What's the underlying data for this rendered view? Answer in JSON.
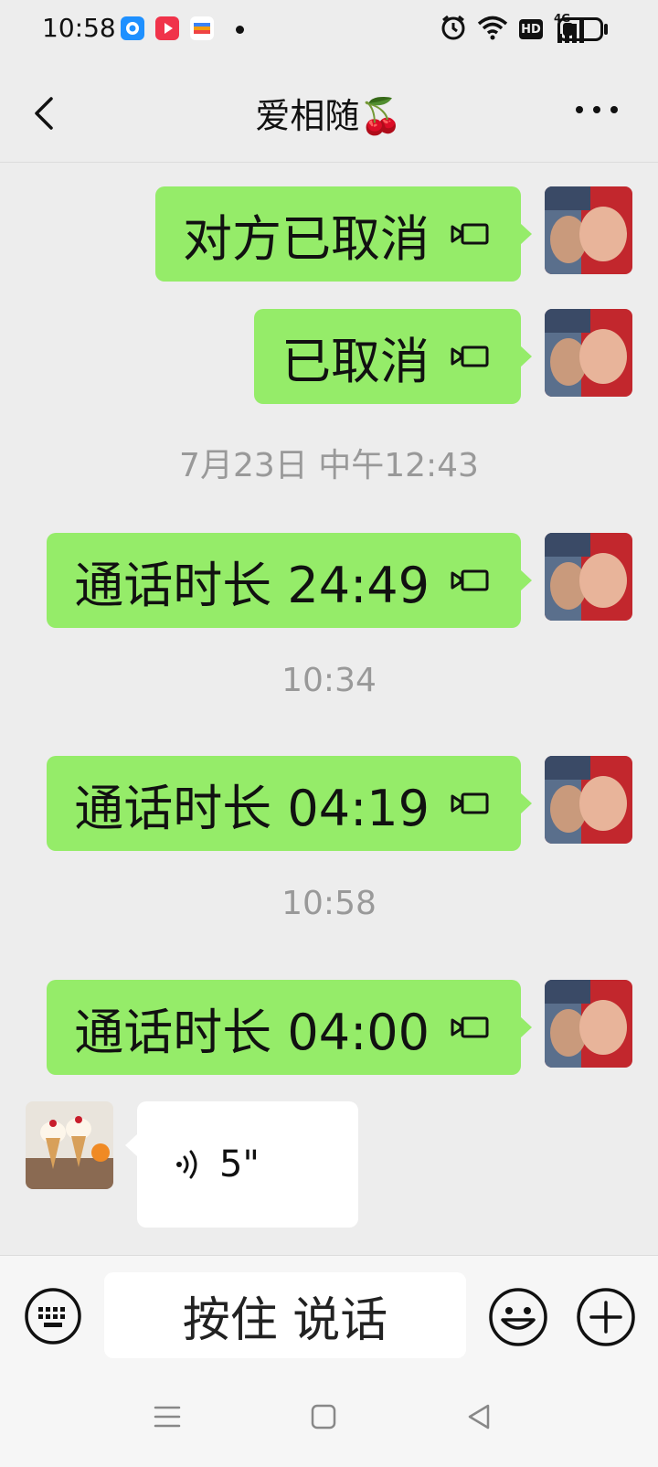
{
  "status_bar": {
    "time": "10:58",
    "app_icons": [
      "browser-icon",
      "video-app-icon",
      "wallet-app-icon"
    ],
    "system_icons": [
      "alarm-icon",
      "wifi-icon",
      "hd-icon",
      "signal-4g-icon",
      "battery-icon"
    ],
    "hd_label": "HD",
    "network_label": "4G",
    "battery_level": 0.3
  },
  "header": {
    "title": "爱相随🍒"
  },
  "messages": [
    {
      "type": "video-call",
      "side": "me",
      "text": "对方已取消"
    },
    {
      "type": "video-call",
      "side": "me",
      "text": "已取消"
    },
    {
      "type": "timestamp",
      "text": "7月23日 中午12:43"
    },
    {
      "type": "video-call",
      "side": "me",
      "text": "通话时长 24:49"
    },
    {
      "type": "timestamp",
      "text": "10:34"
    },
    {
      "type": "video-call",
      "side": "me",
      "text": "通话时长 04:19"
    },
    {
      "type": "timestamp",
      "text": "10:58"
    },
    {
      "type": "video-call",
      "side": "me",
      "text": "通话时长 04:00"
    },
    {
      "type": "voice",
      "side": "other",
      "text": "5\""
    }
  ],
  "input_bar": {
    "hold_to_talk": "按住 说话"
  },
  "colors": {
    "my_bubble": "#95ec69",
    "other_bubble": "#ffffff",
    "background": "#ededed",
    "timestamp": "#999999"
  }
}
